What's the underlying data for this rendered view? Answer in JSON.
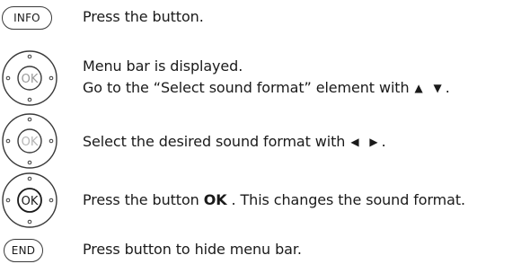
{
  "steps": [
    {
      "button_label": "INFO",
      "lines": [
        "Press the button."
      ]
    },
    {
      "button_label": "OK",
      "lines": [
        "Menu bar is displayed.",
        "Go to the “Select sound format” element with"
      ],
      "arrows": "▲ ▼",
      "trail": "."
    },
    {
      "button_label": "OK",
      "lines": [
        "Select the desired sound format with"
      ],
      "arrows": "◀ ▶",
      "trail": "."
    },
    {
      "button_label": "OK",
      "text_before": "Press the button ",
      "bold": "OK",
      "text_after": " . This changes the sound format."
    },
    {
      "button_label": "END",
      "lines": [
        "Press button to hide menu bar."
      ]
    }
  ],
  "icons": [
    "info-button-icon",
    "dpad-ok-icon-up-down",
    "dpad-ok-icon-left-right",
    "dpad-ok-icon-center",
    "end-button-icon"
  ]
}
